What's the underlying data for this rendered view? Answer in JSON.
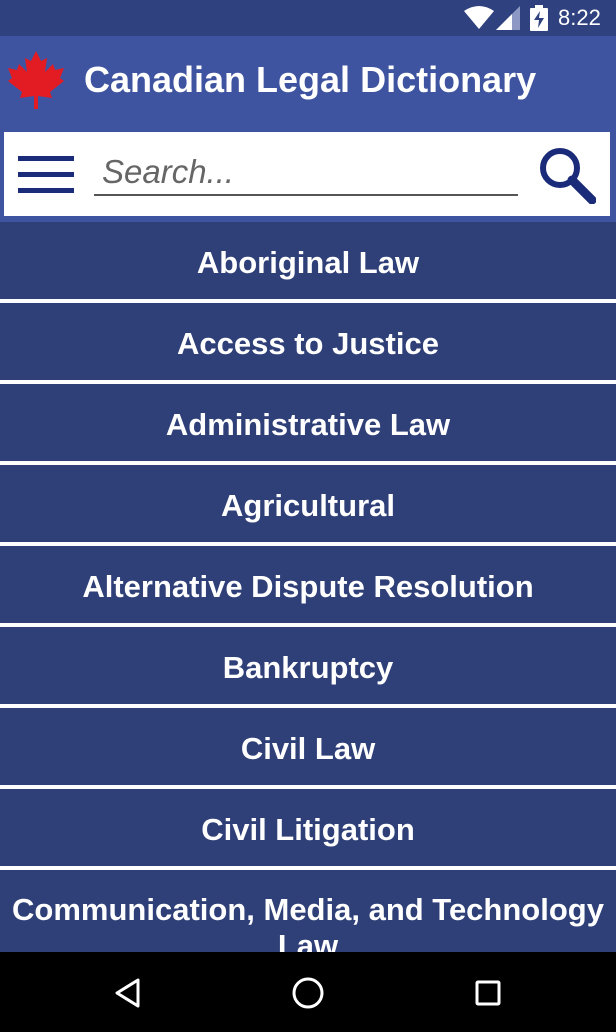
{
  "status_bar": {
    "time": "8:22",
    "icons": [
      "wifi-icon",
      "cell-signal-icon",
      "battery-charging-icon"
    ]
  },
  "app_bar": {
    "title": "Canadian Legal Dictionary",
    "logo_icon": "maple-leaf-icon",
    "brand_color": "#3f54a0",
    "logo_color": "#e31b23"
  },
  "search": {
    "placeholder": "Search...",
    "value": "",
    "menu_icon": "hamburger-menu-icon",
    "search_icon": "search-icon",
    "icon_color": "#1a2b7a"
  },
  "categories": {
    "item_color": "#2f3f78",
    "items": [
      "Aboriginal Law",
      "Access to Justice",
      "Administrative Law",
      "Agricultural",
      "Alternative Dispute Resolution",
      "Bankruptcy",
      "Civil Law",
      "Civil Litigation",
      "Communication, Media, and Technology Law"
    ]
  },
  "nav_bar": {
    "buttons": [
      "back-icon",
      "home-icon",
      "recents-icon"
    ]
  }
}
